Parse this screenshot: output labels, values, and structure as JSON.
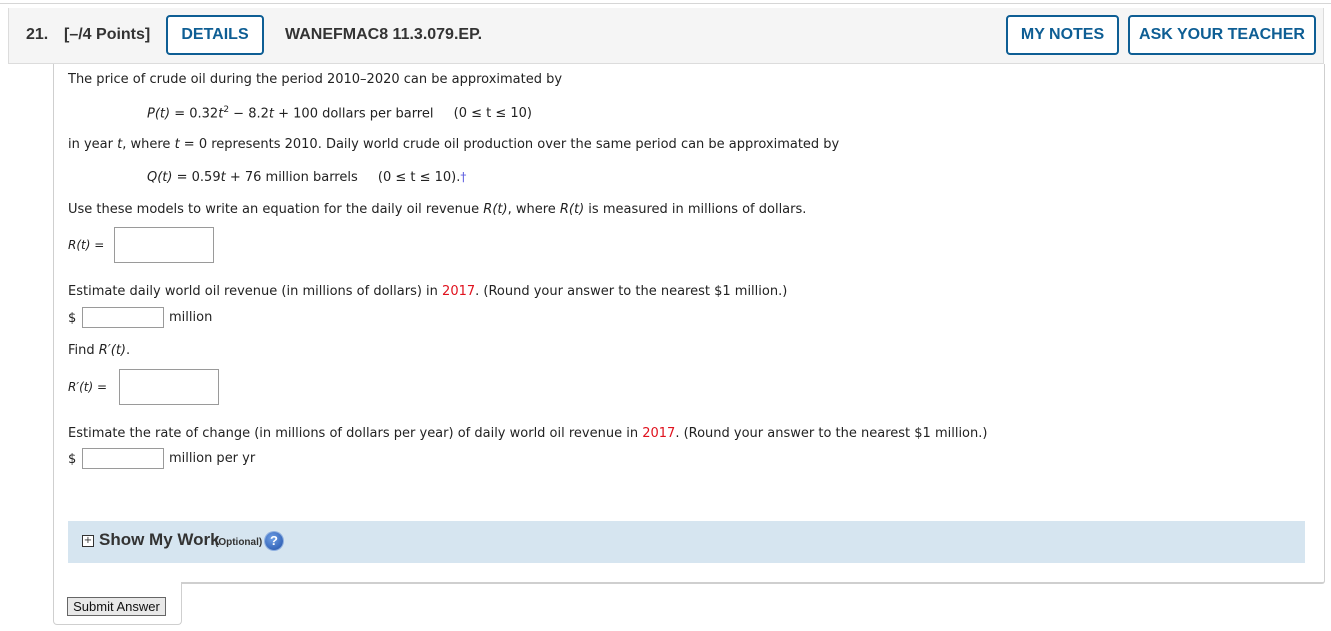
{
  "header": {
    "question_number": "21.",
    "points": "[–/4 Points]",
    "details_label": "DETAILS",
    "question_id": "WANEFMAC8 11.3.079.EP.",
    "my_notes_label": "MY NOTES",
    "ask_teacher_label": "ASK YOUR TEACHER"
  },
  "problem": {
    "intro": "The price of crude oil during the period 2010–2020 can be approximated by",
    "price_model": {
      "lhs": "P(t)",
      "eq_a": " = 0.32",
      "t1": "t",
      "exp": "2",
      "eq_b": " − 8.2",
      "t2": "t",
      "eq_c": " + 100 dollars per barrel",
      "domain": "(0 ≤ t ≤ 10)"
    },
    "middle_a": "in year ",
    "middle_t": "t",
    "middle_b": ", where ",
    "middle_t2": "t",
    "middle_c": " = 0 represents 2010. Daily world crude oil production over the same period can be approximated by",
    "production_model": {
      "lhs": "Q(t)",
      "eq_a": " = 0.59",
      "t1": "t",
      "eq_b": " + 76 million barrels",
      "domain": "(0 ≤ t ≤ 10).",
      "dagger": "†"
    },
    "task": {
      "a": "Use these models to write an equation for the daily oil revenue ",
      "r1": "R(t)",
      "b": ", where ",
      "r2": "R(t)",
      "c": " is measured in millions of dollars."
    }
  },
  "parts": {
    "r_label": "R(t)",
    "eq_sign": " =",
    "revenue_q_a": "Estimate daily world oil revenue (in millions of dollars) in ",
    "revenue_q_year": "2017",
    "revenue_q_b": ". (Round your answer to the nearest $1 million.)",
    "dollar": "$",
    "million": "million",
    "find_a": "Find ",
    "find_r": "R′(t)",
    "find_b": ".",
    "rprime_label": "R′(t)",
    "rate_q_a": "Estimate the rate of change (in millions of dollars per year) of daily world oil revenue in ",
    "rate_q_year": "2017",
    "rate_q_b": ". (Round your answer to the nearest $1 million.)",
    "million_per_yr": "million per yr"
  },
  "inputs": {
    "r_value": "",
    "revenue_value": "",
    "rprime_value": "",
    "rate_value": ""
  },
  "show_work": {
    "expand_icon": "+",
    "label": "Show My Work",
    "optional": "(Optional)",
    "help": "?"
  },
  "submit_label": "Submit Answer",
  "colors": {
    "accent": "#0e5e94",
    "highlight_year": "#e0121e",
    "show_work_bg": "#d6e5f0"
  }
}
